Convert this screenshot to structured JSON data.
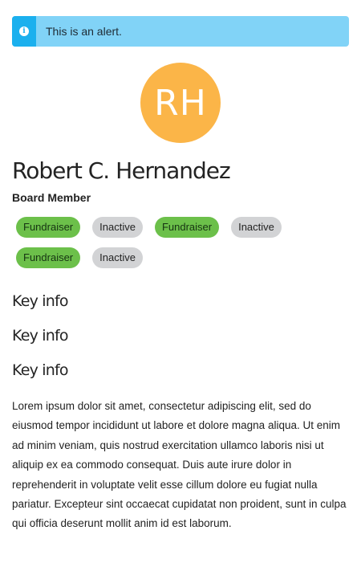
{
  "alert": {
    "icon": "info-icon",
    "text": "This is an alert.",
    "colors": {
      "background": "#81d3f7",
      "icon_background": "#1bb0ee"
    }
  },
  "profile": {
    "initials": "RH",
    "avatar_color": "#fbb548",
    "name": "Robert C. Hernandez",
    "role": "Board Member"
  },
  "tags": [
    {
      "label": "Fundraiser",
      "status": "green"
    },
    {
      "label": "Inactive",
      "status": "gray"
    },
    {
      "label": "Fundraiser",
      "status": "green"
    },
    {
      "label": "Inactive",
      "status": "gray"
    },
    {
      "label": "Fundraiser",
      "status": "green"
    },
    {
      "label": "Inactive",
      "status": "gray"
    }
  ],
  "tag_colors": {
    "green": "#6cc04a",
    "gray": "#d2d3d5"
  },
  "sections": [
    {
      "title": "Key info"
    },
    {
      "title": "Key info"
    },
    {
      "title": "Key info"
    }
  ],
  "body_text": "Lorem ipsum dolor sit amet, consectetur adipiscing elit, sed do eiusmod tempor incididunt ut labore et dolore magna aliqua. Ut enim ad minim veniam, quis nostrud exercitation ullamco laboris nisi ut aliquip ex ea commodo consequat. Duis aute irure dolor in reprehenderit in voluptate velit esse cillum dolore eu fugiat nulla pariatur. Excepteur sint occaecat cupidatat non proident, sunt in culpa qui officia deserunt mollit anim id est laborum."
}
